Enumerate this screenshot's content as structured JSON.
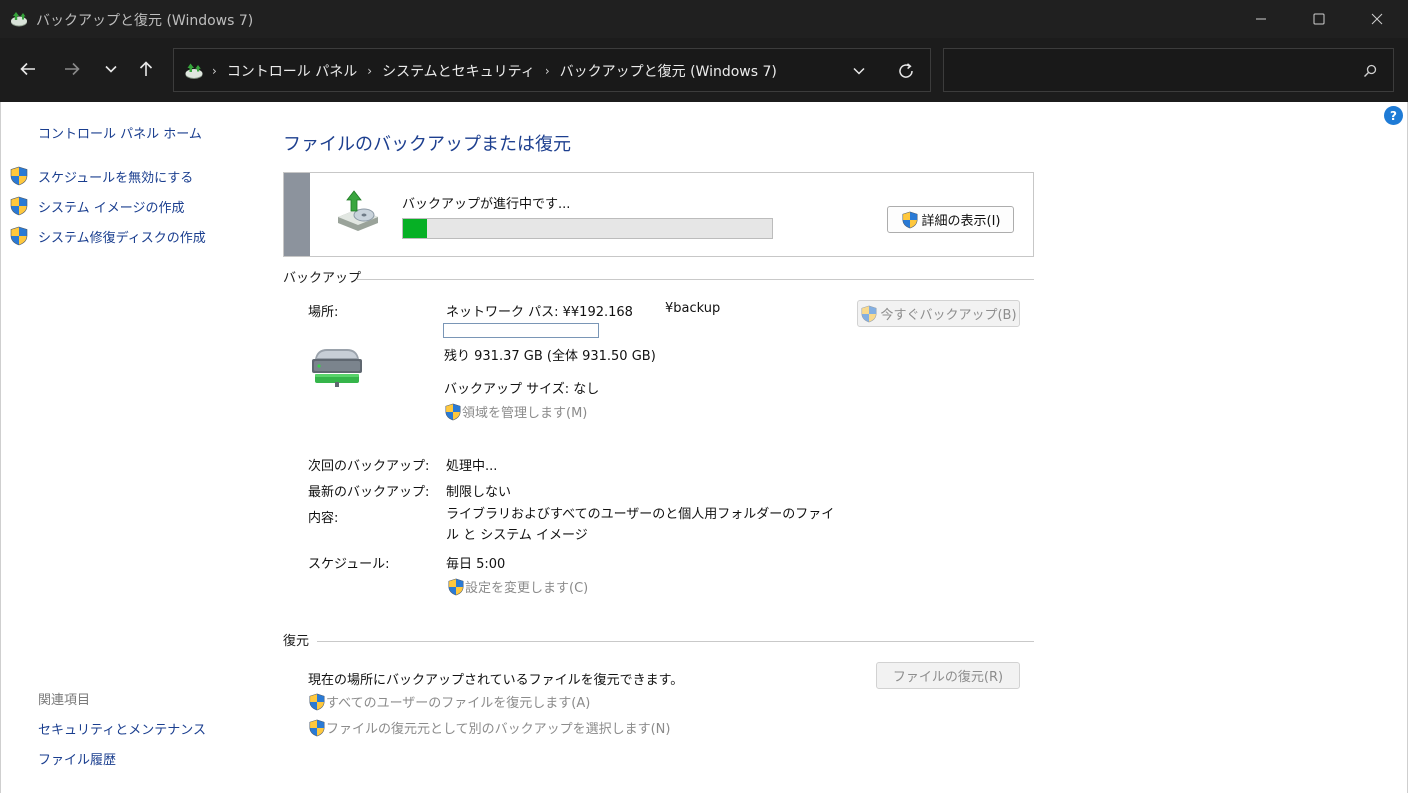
{
  "window": {
    "title": "バックアップと復元 (Windows 7)"
  },
  "nav": {
    "breadcrumbs": [
      "コントロール パネル",
      "システムとセキュリティ",
      "バックアップと復元 (Windows 7)"
    ],
    "search_placeholder": ""
  },
  "sidebar": {
    "home": "コントロール パネル ホーム",
    "tasks": [
      {
        "label": "スケジュールを無効にする"
      },
      {
        "label": "システム イメージの作成"
      },
      {
        "label": "システム修復ディスクの作成"
      }
    ],
    "see_also_title": "関連項目",
    "see_also": [
      "セキュリティとメンテナンス",
      "ファイル履歴"
    ]
  },
  "main": {
    "title": "ファイルのバックアップまたは復元",
    "status_text": "バックアップが進行中です...",
    "progress_fraction": 0.065,
    "details_button": "詳細の表示(I)"
  },
  "backup": {
    "section_title": "バックアップ",
    "location_label": "場所:",
    "location_value": "ネットワーク パス: ¥¥192.168",
    "location_suffix": "¥backup",
    "backup_now_button": "今すぐバックアップ(B)",
    "space_used_fraction": 0.0,
    "free_space": "残り 931.37 GB (全体 931.50 GB)",
    "backup_size": "バックアップ サイズ: なし",
    "manage_space_link": "領域を管理します(M)",
    "next_label": "次回のバックアップ:",
    "next_value": "処理中...",
    "last_label": "最新のバックアップ:",
    "last_value": "制限しない",
    "contents_label": "内容:",
    "contents_value": "ライブラリおよびすべてのユーザーのと個人用フォルダーのファイル と システム イメージ",
    "schedule_label": "スケジュール:",
    "schedule_value": "毎日 5:00",
    "change_settings_link": "設定を変更します(C)"
  },
  "restore": {
    "section_title": "復元",
    "description": "現在の場所にバックアップされているファイルを復元できます。",
    "restore_files_button": "ファイルの復元(R)",
    "restore_all_users_link": "すべてのユーザーのファイルを復元します(A)",
    "select_other_backup_link": "ファイルの復元元として別のバックアップを選択します(N)"
  },
  "colors": {
    "link": "#1a3e8f",
    "title": "#1d3f8f",
    "progress": "#06b025",
    "disabled_text": "#8b8b8b"
  },
  "icons": {
    "app": "backup-restore-icon",
    "uac": "uac-shield-icon",
    "drive": "network-drive-icon",
    "help": "help-icon"
  }
}
